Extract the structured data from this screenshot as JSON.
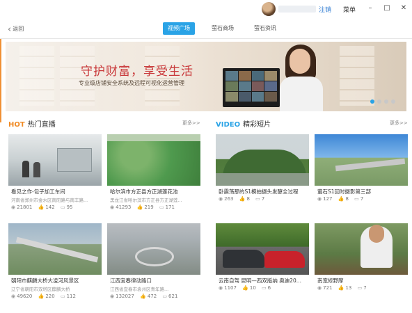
{
  "titlebar": {
    "logout": "注销",
    "menu": "菜单",
    "minimize": "–",
    "maximize": "□",
    "close": "✕"
  },
  "nav": {
    "back": "返回",
    "tabs": [
      "视频广场",
      "萤石商场",
      "萤石资讯"
    ]
  },
  "banner": {
    "title": "守护财富，享受生活",
    "subtitle": "专业级店铺安全系统及远程可视化运营管理"
  },
  "hot": {
    "prefix": "HOT",
    "title": "热门直播",
    "more": "更多>>",
    "items": [
      {
        "title": "看见之作-包子加工车间",
        "subtitle": "河南省郑州市金水区南阳路与南丰路...",
        "views": "21801",
        "likes": "142",
        "comments": "95"
      },
      {
        "title": "哈尔滨市方正县方正湖莲花池",
        "subtitle": "黑龙江省哈尔滨市方正县方正湖莲...",
        "views": "41293",
        "likes": "219",
        "comments": "171"
      },
      {
        "title": "朝阳市麒麟大桥大凌河风景区",
        "subtitle": "辽宁省朝阳市双塔区麒麟大桥",
        "views": "49620",
        "likes": "220",
        "comments": "112"
      },
      {
        "title": "江西宜春律动路口",
        "subtitle": "江西省宜春市袁州区青年路...",
        "views": "132027",
        "likes": "472",
        "comments": "621"
      }
    ]
  },
  "video": {
    "prefix": "VIDEO",
    "title": "精彩短片",
    "more": "更多>>",
    "items": [
      {
        "title": "卧震荡那的S1模拍摄头发酵全过程",
        "views": "263",
        "likes": "8",
        "comments": "7"
      },
      {
        "title": "萤石S1回时摄影第三部",
        "views": "127",
        "likes": "8",
        "comments": "7"
      },
      {
        "title": "云南自驾 昆明—西双版纳 奥迪20...",
        "views": "1107",
        "likes": "10",
        "comments": "6"
      },
      {
        "title": "南宽修野摩",
        "views": "721",
        "likes": "13",
        "comments": "7"
      }
    ]
  }
}
